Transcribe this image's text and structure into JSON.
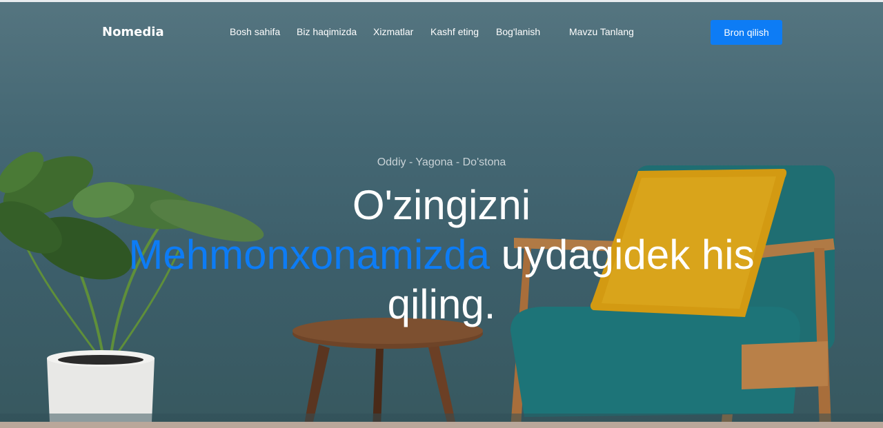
{
  "brand": "Nomedia",
  "nav": {
    "items": [
      {
        "label": "Bosh sahifa"
      },
      {
        "label": "Biz haqimizda"
      },
      {
        "label": "Xizmatlar"
      },
      {
        "label": "Kashf eting"
      },
      {
        "label": "Bog'lanish"
      },
      {
        "label": "Mavzu Tanlang"
      }
    ],
    "cta": "Bron qilish"
  },
  "hero": {
    "tagline": "Oddiy - Yagona - Do'stona",
    "headline_line1": "O'zingizni",
    "headline_accent": "Mehmonxonamizda",
    "headline_rest": " uydagidek his",
    "headline_line3": "qiling."
  },
  "colors": {
    "accent": "#0d7cf5",
    "wall": "#3d5f6b",
    "chair": "#1f6e72",
    "pillow": "#d39a12"
  }
}
